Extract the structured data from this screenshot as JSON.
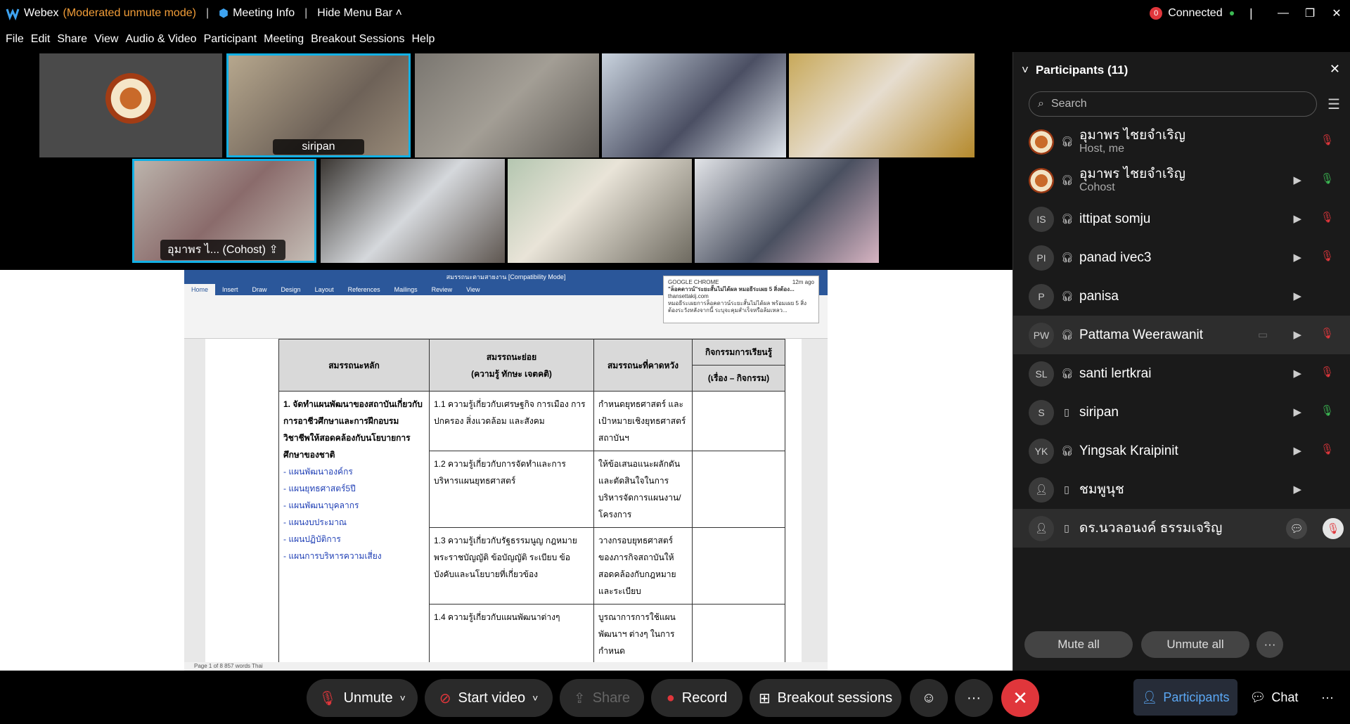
{
  "titlebar": {
    "app_name": "Webex",
    "mode": "(Moderated unmute mode)",
    "sep": "|",
    "meeting_info": "Meeting Info",
    "hide_menu": "Hide Menu Bar",
    "status_count": "0",
    "connection": "Connected"
  },
  "menu": [
    "File",
    "Edit",
    "Share",
    "View",
    "Audio & Video",
    "Participant",
    "Meeting",
    "Breakout Sessions",
    "Help"
  ],
  "tiles": {
    "siripan": "siripan",
    "cohost": "อุมาพร ไ... (Cohost)"
  },
  "word": {
    "title": "สมรรถนะตามสายงาน [Compatibility Mode]",
    "tabs": [
      "Home",
      "Insert",
      "Draw",
      "Design",
      "Layout",
      "References",
      "Mailings",
      "Review",
      "View"
    ],
    "toast_source": "GOOGLE CHROME",
    "toast_time": "12m ago",
    "toast_title": "\"ล็อคดาวน์\"ระยะสั้นไม่ได้ผล หมอธีระเผย 5 สิ่งต้อง...",
    "toast_site": "thansettakij.com",
    "toast_body": "หมอธีระเผยการล็อคดาวน์ระยะสั้นไม่ได้ผล พร้อมเผย 5 สิ่งต้องระวังหลังจากนี้ ระบุจะคุมสำเร็จหรือล้มเหลว...",
    "status": "Page 1 of 8    857 words    Thai",
    "table": {
      "h_main": "สมรรถนะหลัก",
      "h_sub1": "สมรรถนะย่อย",
      "h_sub2": "(ความรู้ ทักษะ เจตคติ)",
      "h_expect": "สมรรถนะที่คาดหวัง",
      "h_activity": "กิจกรรมการเรียนรู้",
      "h_activity2": "(เรื่อง – กิจกรรม)",
      "main_text": "1. จัดทำแผนพัฒนาของสถาบันเกี่ยวกับการอาชีวศึกษาและการฝึกอบรมวิชาชีพให้สอดคล้องกับนโยบายการศึกษาของชาติ",
      "main_items": [
        "- แผนพัฒนาองค์กร",
        "- แผนยุทธศาสตร์5ปี",
        "- แผนพัฒนาบุคลากร",
        "- แผนงบประมาณ",
        "- แผนปฏิบัติการ",
        "- แผนการบริหารความเสี่ยง"
      ],
      "rows": [
        {
          "sub": "1.1 ความรู้เกี่ยวกับเศรษฐกิจ การเมือง การปกครอง สิ่งแวดล้อม และสังคม",
          "expect": "กำหนดยุทธศาสตร์ และเป้าหมายเชิงยุทธศาสตร์สถาบันฯ"
        },
        {
          "sub": "1.2 ความรู้เกี่ยวกับการจัดทำและการบริหารแผนยุทธศาสตร์",
          "expect": "ให้ข้อเสนอแนะผลักดันและตัดสินใจในการบริหารจัดการแผนงาน/โครงการ"
        },
        {
          "sub": "1.3 ความรู้เกี่ยวกับรัฐธรรมนูญ กฎหมาย พระราชบัญญัติ ข้อบัญญัติ ระเบียบ ข้อบังคับและนโยบายที่เกี่ยวข้อง",
          "expect": "วางกรอบยุทธศาสตร์ของภารกิจสถาบันให้สอดคล้องกับกฎหมายและระเบียบ"
        },
        {
          "sub": "1.4 ความรู้เกี่ยวกับแผนพัฒนาต่างๆ",
          "expect": "บูรณาการการใช้แผนพัฒนาฯ ต่างๆ ในการกำหนด"
        }
      ]
    }
  },
  "panel": {
    "title": "Participants (11)",
    "search_placeholder": "Search",
    "mute_all": "Mute all",
    "unmute_all": "Unmute all",
    "participants": [
      {
        "name": "อุมาพร ไชยจำเริญ",
        "role": "Host, me",
        "initials": "",
        "video": false,
        "mic": "off"
      },
      {
        "name": "อุมาพร ไชยจำเริญ",
        "role": "Cohost",
        "initials": "",
        "video": true,
        "mic": "on"
      },
      {
        "name": "ittipat somju",
        "role": "",
        "initials": "IS",
        "video": true,
        "mic": "off"
      },
      {
        "name": "panad ivec3",
        "role": "",
        "initials": "PI",
        "video": true,
        "mic": "off"
      },
      {
        "name": "panisa",
        "role": "",
        "initials": "P",
        "video": true,
        "mic": "none"
      },
      {
        "name": "Pattama Weerawanit",
        "role": "",
        "initials": "PW",
        "video": true,
        "mic": "off"
      },
      {
        "name": "santi lertkrai",
        "role": "",
        "initials": "SL",
        "video": true,
        "mic": "off"
      },
      {
        "name": "siripan",
        "role": "",
        "initials": "S",
        "video": true,
        "mic": "on"
      },
      {
        "name": "Yingsak Kraipinit",
        "role": "",
        "initials": "YK",
        "video": true,
        "mic": "off"
      },
      {
        "name": "ชมพูนุช",
        "role": "",
        "initials": "",
        "video": true,
        "mic": "none"
      },
      {
        "name": "ดร.นวลอนงค์ ธรรมเจริญ",
        "role": "",
        "initials": "",
        "video": false,
        "mic": "off"
      }
    ]
  },
  "bottombar": {
    "unmute": "Unmute",
    "start_video": "Start video",
    "share": "Share",
    "record": "Record",
    "breakout": "Breakout sessions",
    "participants": "Participants",
    "chat": "Chat",
    "more": "···",
    "end": "✕"
  },
  "colors": {
    "accent": "#12b1e6",
    "end_red": "#e0363b",
    "mode_orange": "#f29d38"
  }
}
